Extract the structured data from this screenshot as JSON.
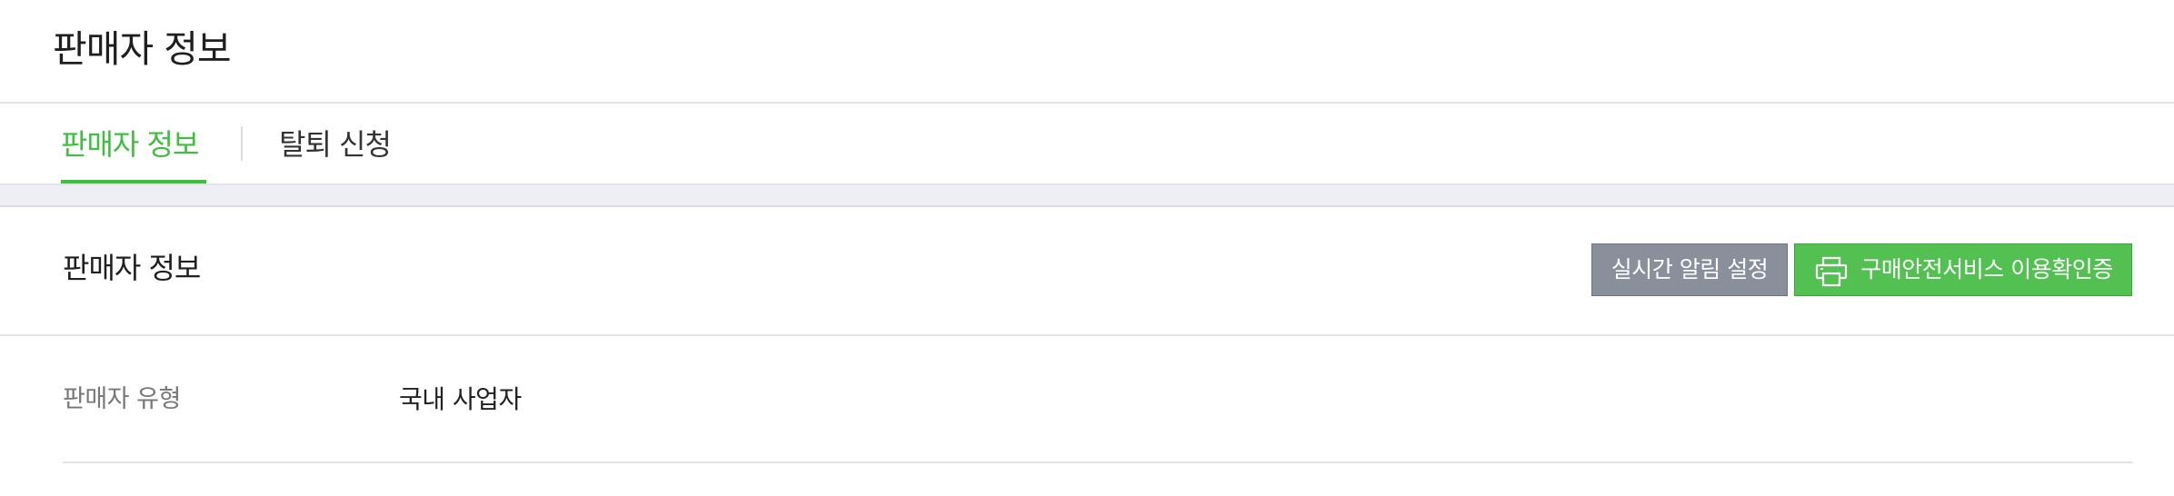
{
  "page": {
    "title": "판매자 정보"
  },
  "tabs": [
    {
      "label": "판매자 정보",
      "active": true
    },
    {
      "label": "탈퇴 신청",
      "active": false
    }
  ],
  "section": {
    "title": "판매자 정보",
    "buttons": {
      "realtime_alert": "실시간 알림 설정",
      "purchase_safety": "구매안전서비스 이용확인증",
      "purchase_safety_icon": "printer-icon"
    }
  },
  "rows": [
    {
      "label": "판매자 유형",
      "value": "국내 사업자"
    }
  ],
  "colors": {
    "accent": "#3fbf3f",
    "gray_button": "#8a8f9c",
    "green_button": "#52c152"
  }
}
